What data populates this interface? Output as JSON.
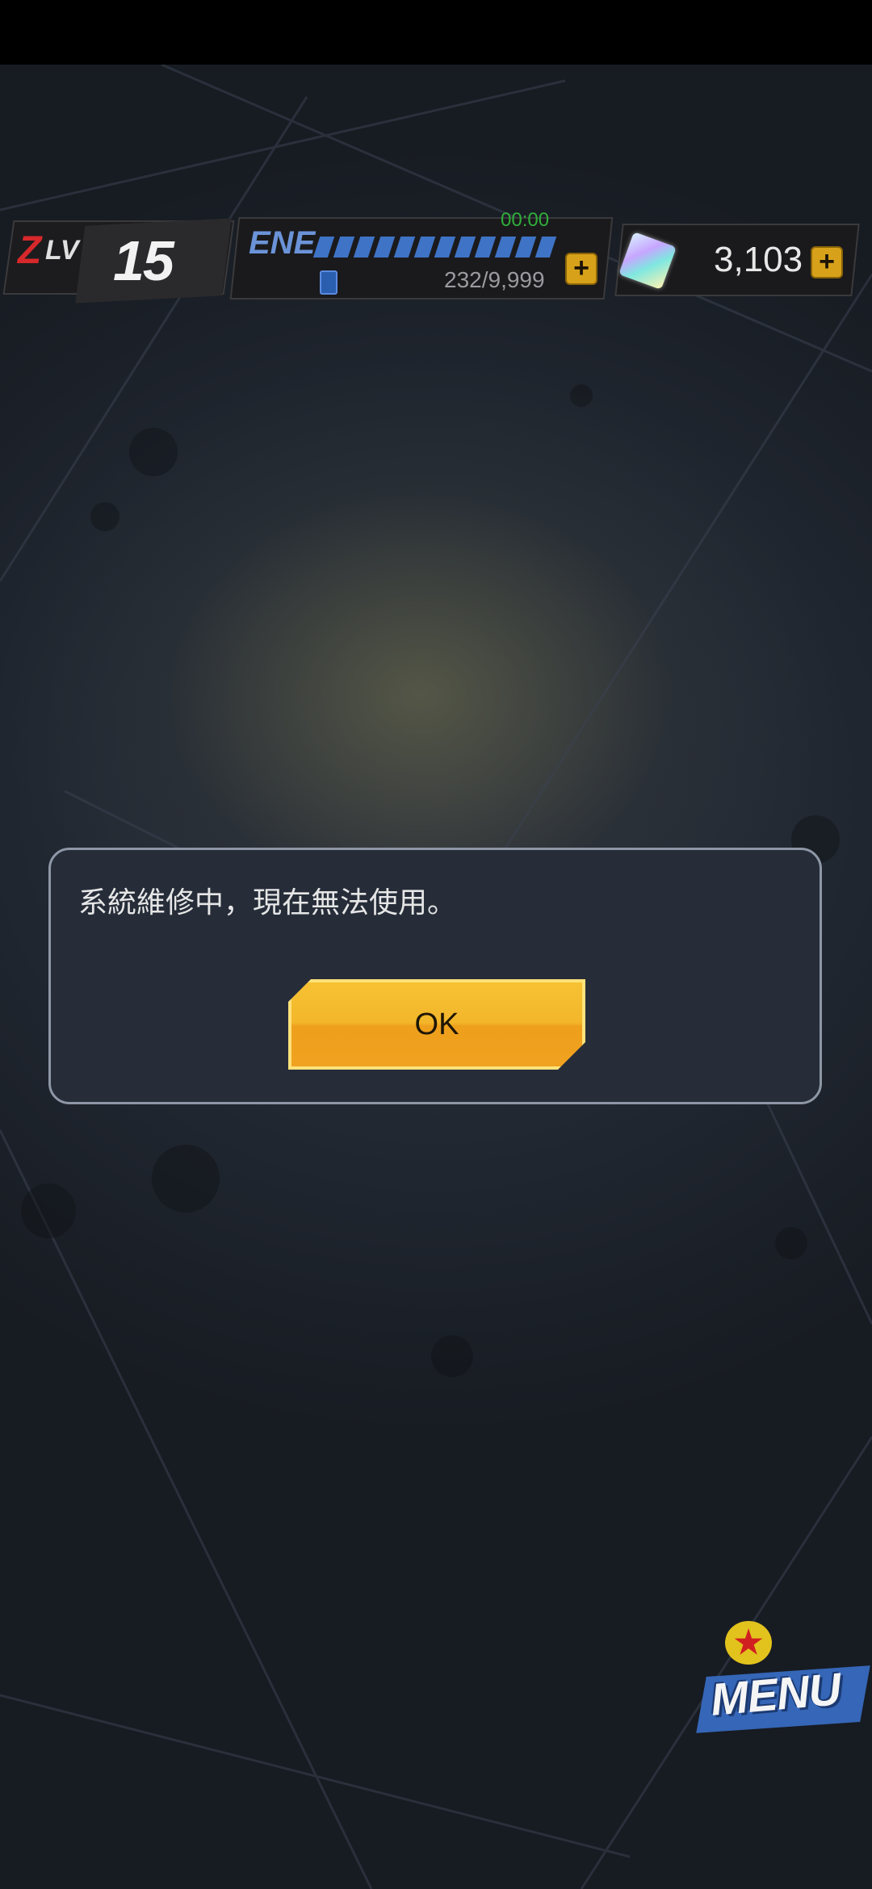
{
  "hud": {
    "level_prefix": "Z",
    "level_label": "LV",
    "level_value": "15",
    "energy_label": "ENE",
    "energy_timer": "00:00",
    "energy_value": "232/9,999",
    "energy_plus": "+",
    "gem_value": "3,103",
    "gem_plus": "+"
  },
  "dialog": {
    "message": "系統維修中，現在無法使用。",
    "ok_label": "OK"
  },
  "menu": {
    "label": "MENU",
    "badge_icon": "star-icon"
  },
  "colors": {
    "accent_gold": "#f3b62a",
    "energy_blue": "#3f73c6",
    "timer_green": "#2fae3a",
    "level_red": "#d7282b"
  }
}
